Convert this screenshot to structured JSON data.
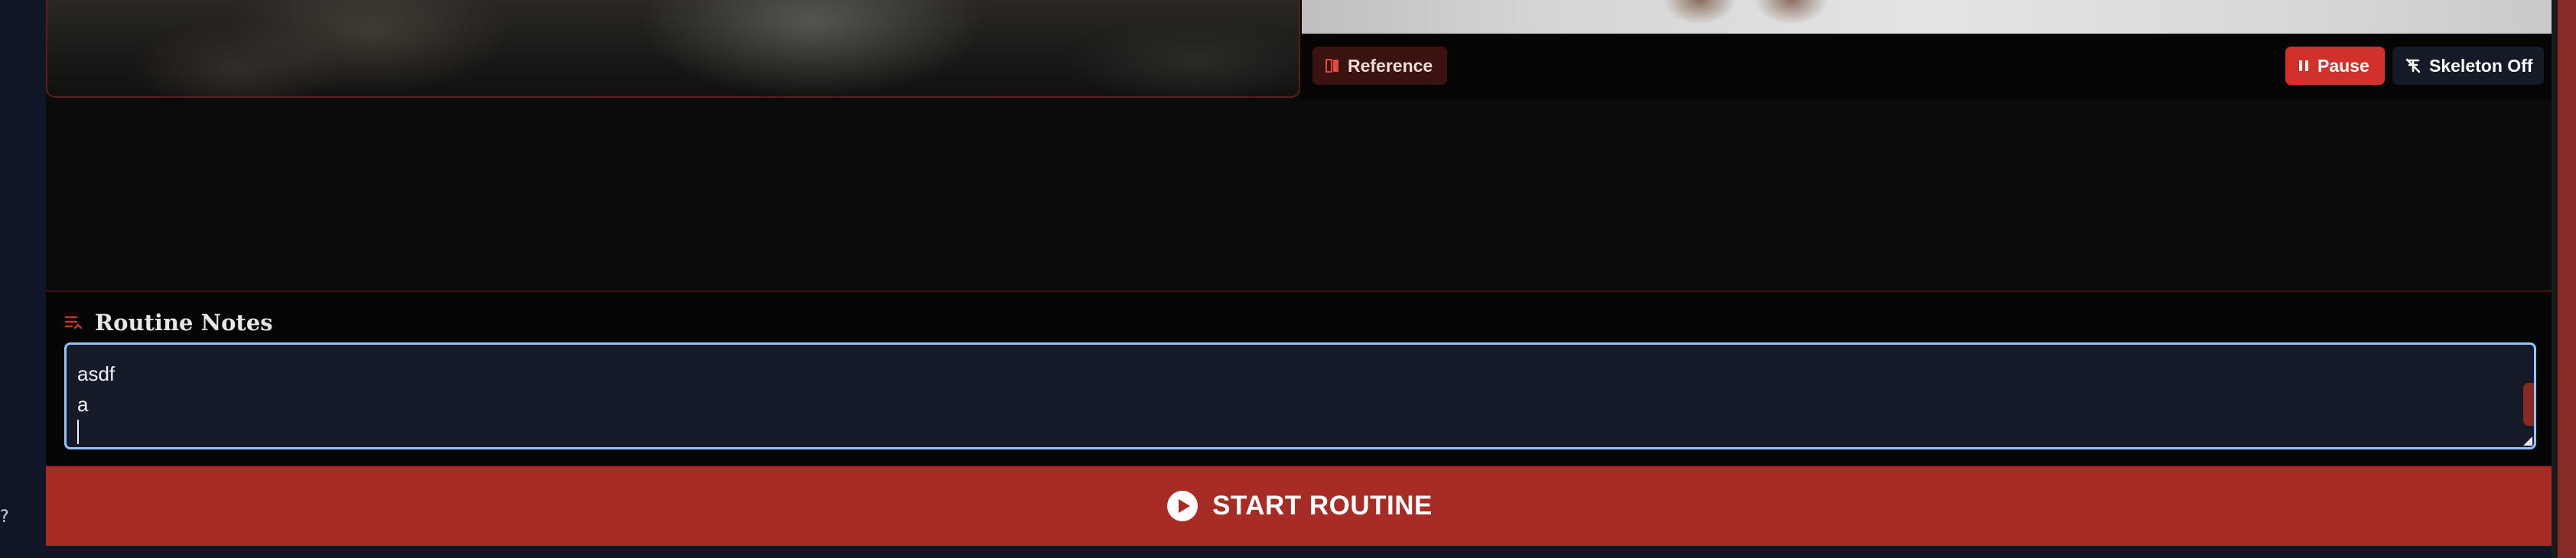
{
  "reference_panel": {
    "reference_label": "Reference",
    "pause_label": "Pause",
    "skeleton_label": "Skeleton Off"
  },
  "notes": {
    "title": "Routine Notes",
    "content": "asdf\na\n"
  },
  "start": {
    "label": "START ROUTINE"
  },
  "rail": {
    "glyph": "?"
  },
  "colors": {
    "accent_red": "#a82c26",
    "pause_red": "#d0322b",
    "focus_ring": "#93c5fd",
    "panel_bg": "#0b0b0b"
  },
  "icons": {
    "reference": "book-icon",
    "pause": "pause-icon",
    "skeleton": "skeleton-off-icon",
    "notes": "notes-list-icon",
    "start": "play-circle-icon"
  }
}
